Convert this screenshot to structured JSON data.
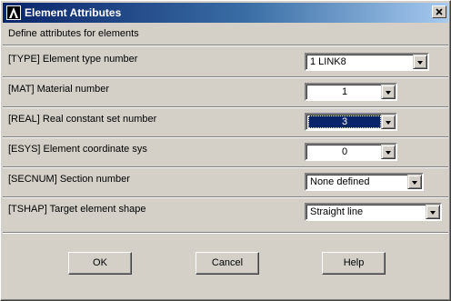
{
  "window": {
    "title": "Element Attributes",
    "header": "Define attributes for elements"
  },
  "rows": [
    {
      "label": "[TYPE]  Element type number",
      "value": "1    LINK8"
    },
    {
      "label": "[MAT]   Material number",
      "value": "1"
    },
    {
      "label": "[REAL]  Real constant set number",
      "value": "3"
    },
    {
      "label": "[ESYS]  Element coordinate sys",
      "value": "0"
    },
    {
      "label": "[SECNUM]  Section number",
      "value": "None defined"
    },
    {
      "label": "[TSHAP]  Target element shape",
      "value": "Straight line"
    }
  ],
  "buttons": {
    "ok": "OK",
    "cancel": "Cancel",
    "help": "Help"
  },
  "icons": {
    "app": "ansys-logo-icon",
    "close": "close-icon",
    "dropdown": "chevron-down-icon"
  }
}
